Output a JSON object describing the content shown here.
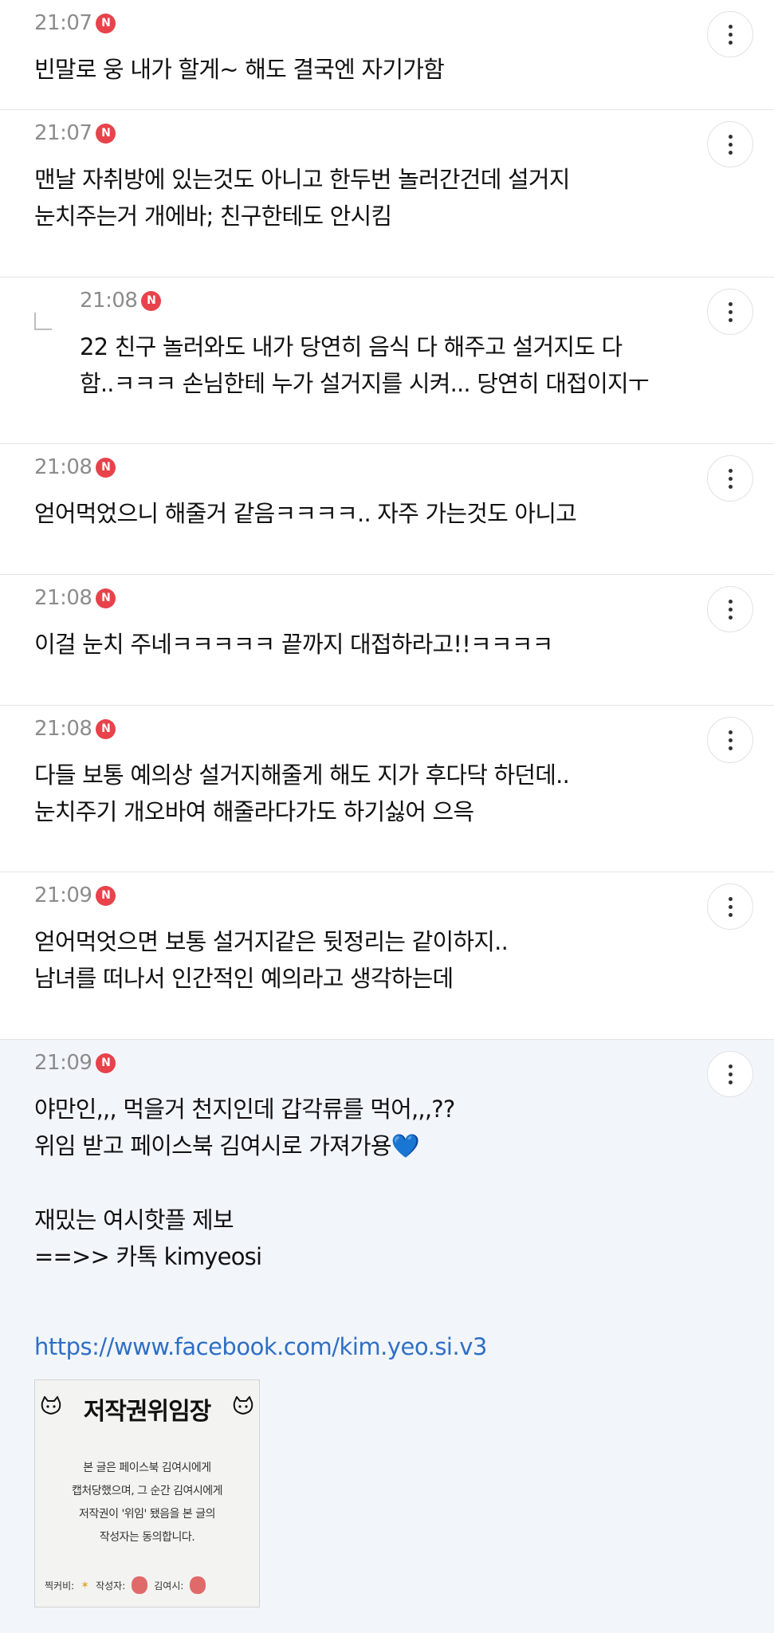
{
  "comments": [
    {
      "time": "21:07",
      "badge": "N",
      "text": "빈말로 웅 내가 할게~ 해도 결국엔 자기가함"
    },
    {
      "time": "21:07",
      "badge": "N",
      "text": "맨날 자취방에 있는것도 아니고 한두번 놀러간건데 설거지\n눈치주는거 개에바; 친구한테도 안시킴"
    },
    {
      "time": "21:08",
      "badge": "N",
      "text": "22 친구 놀러와도 내가 당연히 음식 다 해주고 설거지도 다\n함..ㅋㅋㅋ 손님한테 누가 설거지를 시켜... 당연히 대접이지ㅜ"
    },
    {
      "time": "21:08",
      "badge": "N",
      "text": "얻어먹었으니 해줄거 같음ㅋㅋㅋㅋ.. 자주 가는것도 아니고"
    },
    {
      "time": "21:08",
      "badge": "N",
      "text": "이걸 눈치 주네ㅋㅋㅋㅋㅋ 끝까지 대접하라고!!ㅋㅋㅋㅋ"
    },
    {
      "time": "21:08",
      "badge": "N",
      "text": "다들 보통 예의상 설거지해줄게 해도 지가 후다닥 하던데..\n눈치주기 개오바여 해줄라다가도 하기싫어 으윽"
    },
    {
      "time": "21:09",
      "badge": "N",
      "text": "얻어먹엇으면 보통 설거지같은 뒷정리는 같이하지..\n남녀를 떠나서 인간적인 예의라고 생각하는데"
    },
    {
      "time": "21:09",
      "badge": "N",
      "text": "야만인,,, 먹을거 천지인데 갑각류를 먹어,,,??\n위임 받고 페이스북 김여시로 가져가용"
    }
  ],
  "footer_post": {
    "heart": "💙",
    "tip_line1": "재밌는 여시핫플 제보",
    "tip_line2": "==>> 카톡 kimyeosi",
    "link": "https://www.facebook.com/kim.yeo.si.v3",
    "poster_title": "저작권위임장",
    "poster_text": "본 글은 페이스북 김여시에게\n캡처당했으며, 그 순간 김여시에게\n저작권이 '위임' 됐음을 본 글의\n작성자는 동의합니다.",
    "poster_sign1": "찍커비:",
    "poster_sign2": "작성자:",
    "poster_sign3": "김여시:"
  },
  "colors": {
    "badge": "#e8424b",
    "link": "#2f6fc3",
    "highlight_bg": "#f2f6fb",
    "time": "#8c8c8c"
  },
  "icons": {
    "more": "more-vertical-icon",
    "reply": "reply-arrow-icon",
    "badge": "new-badge-icon"
  }
}
